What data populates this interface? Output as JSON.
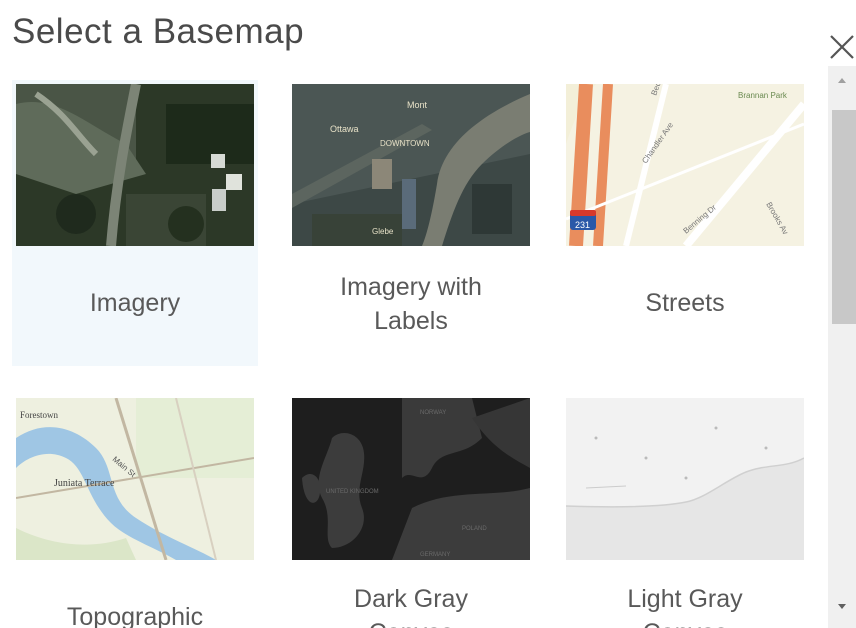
{
  "dialog": {
    "title": "Select a Basemap",
    "close_icon": "close-icon"
  },
  "basemaps": [
    {
      "label": "Imagery",
      "selected": true
    },
    {
      "label": "Imagery with\nLabels"
    },
    {
      "label": "Streets"
    },
    {
      "label": "Topographic"
    },
    {
      "label": "Dark Gray\nCanvas"
    },
    {
      "label": "Light Gray\nCanvas"
    }
  ],
  "thumbnail_text": {
    "streets": [
      "Brannan Park",
      "Bedford Av",
      "Chandler Ave",
      "Benning Dr",
      "Brooks Av",
      "231"
    ],
    "topographic": [
      "Forestown",
      "Juniata Terrace",
      "Main St"
    ],
    "dark_gray": [
      "NORWAY",
      "UNITED KINGDOM",
      "POLAND",
      "GERMANY"
    ]
  },
  "scrollbar": {
    "up_icon": "chevron-up-icon",
    "down_icon": "chevron-down-icon"
  },
  "colors": {
    "selected_background": "#f2f8fc",
    "text": "#595959",
    "title": "#4a4a4a"
  }
}
